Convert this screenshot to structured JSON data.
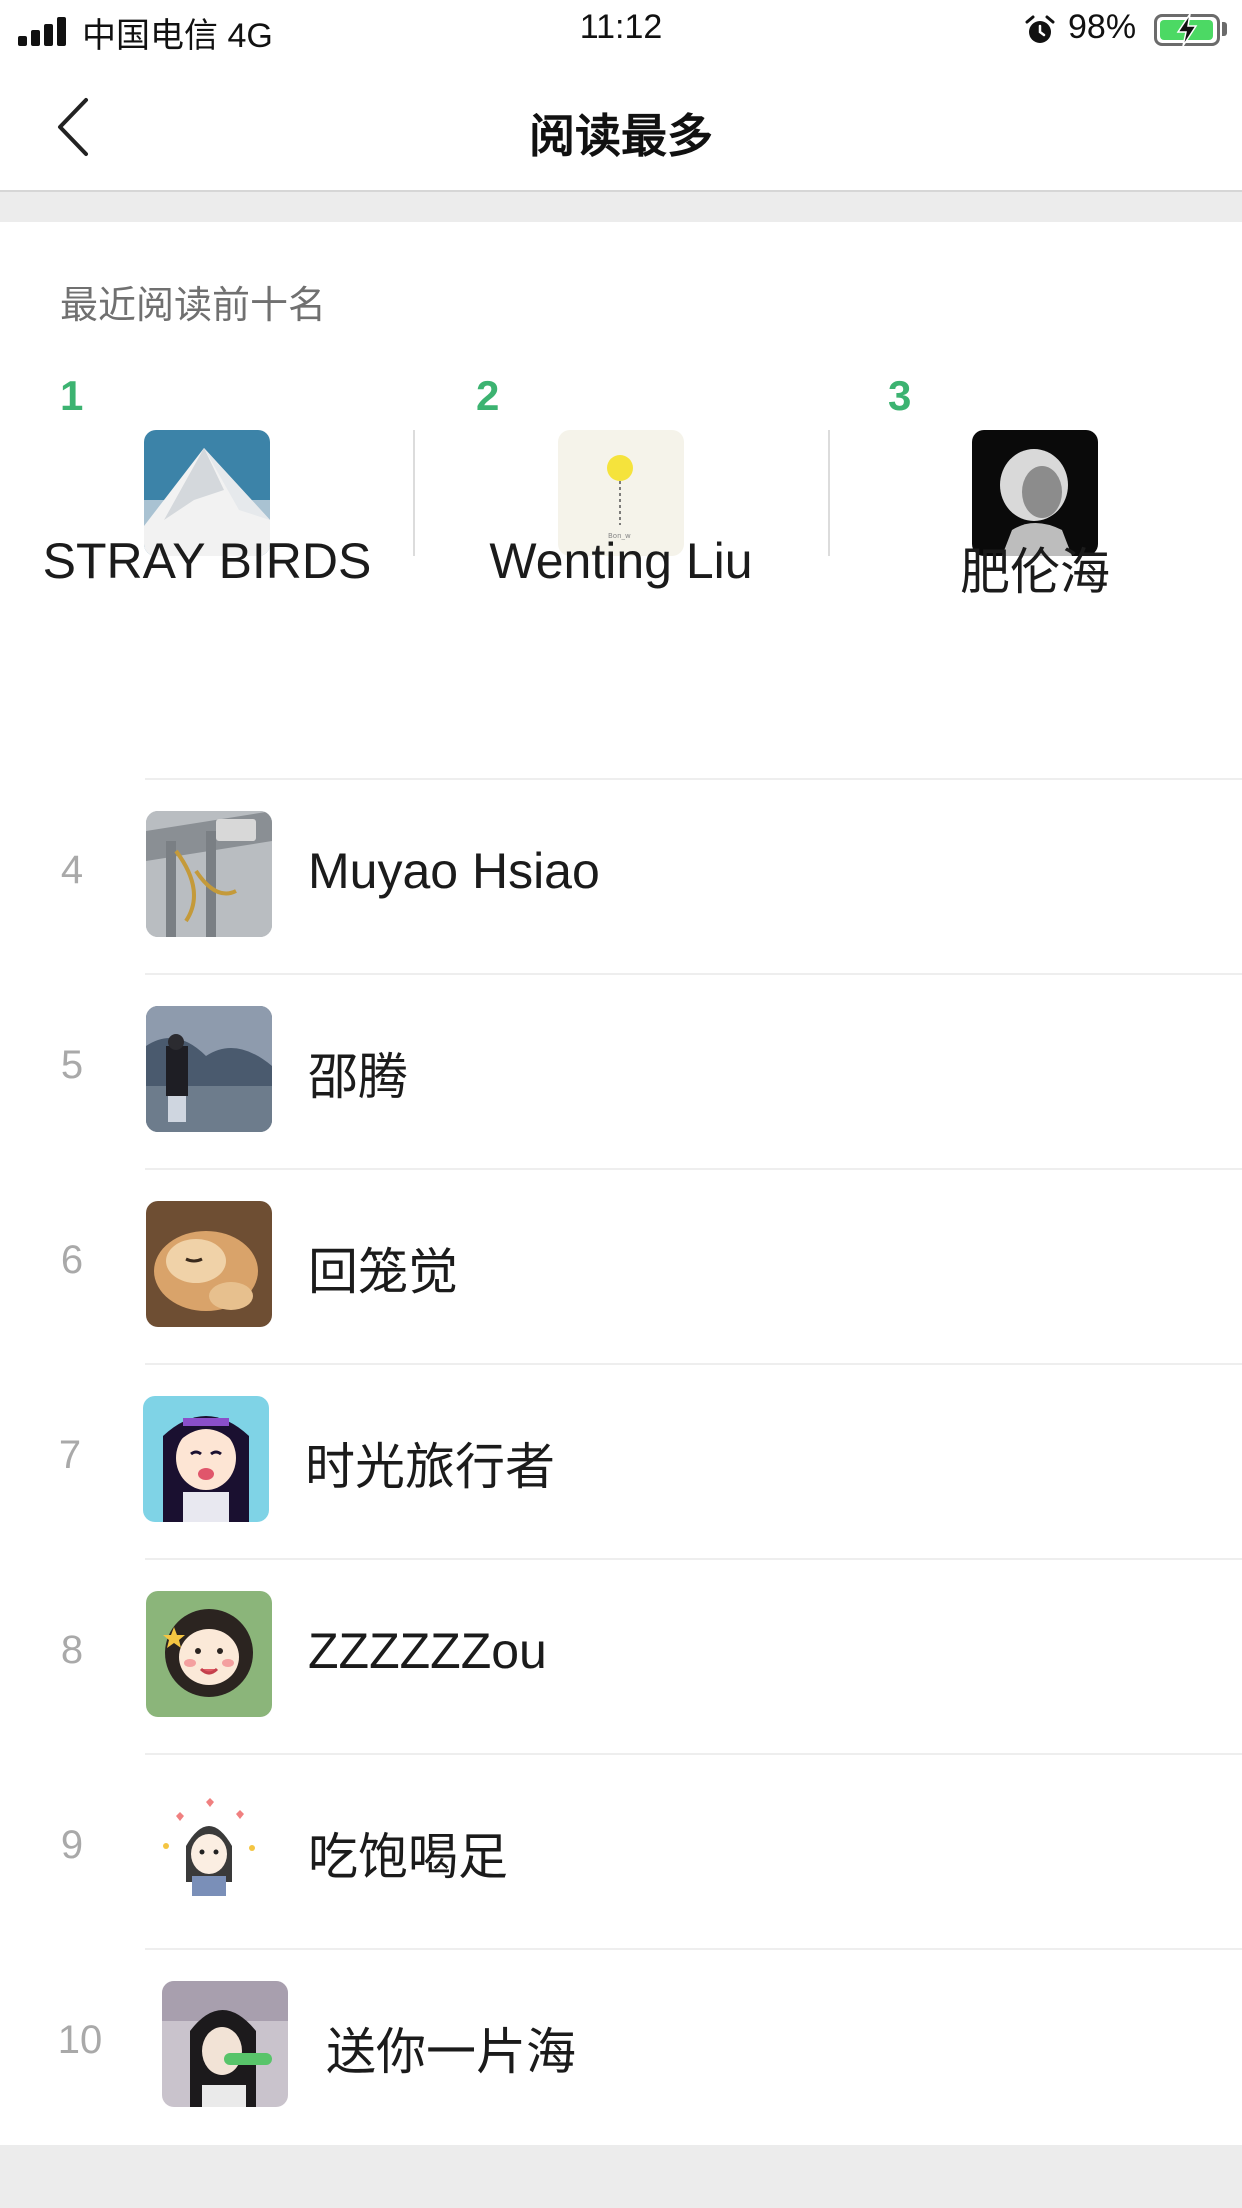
{
  "status_bar": {
    "carrier": "中国电信 4G",
    "time": "11:12",
    "battery_percent": "98%",
    "battery_level": 0.98
  },
  "nav": {
    "title": "阅读最多"
  },
  "section": {
    "label": "最近阅读前十名"
  },
  "top3": [
    {
      "rank": "1",
      "name": "STRAY BIRDS",
      "avatar": "snowy-mountain"
    },
    {
      "rank": "2",
      "name": "Wenting Liu",
      "avatar": "yellow-balloon"
    },
    {
      "rank": "3",
      "name": "肥伦海",
      "avatar": "black-white-portrait"
    }
  ],
  "list": [
    {
      "rank": "4",
      "name": "Muyao Hsiao",
      "avatar": "luggage-photo"
    },
    {
      "rank": "5",
      "name": "邵腾",
      "avatar": "rocky-beach-photo"
    },
    {
      "rank": "6",
      "name": "回笼觉",
      "avatar": "sleeping-dog-photo"
    },
    {
      "rank": "7",
      "name": "时光旅行者",
      "avatar": "anime-girl"
    },
    {
      "rank": "8",
      "name": "ZZZZZZou",
      "avatar": "curly-girl-cartoon"
    },
    {
      "rank": "9",
      "name": "吃饱喝足",
      "avatar": "girl-hearts-cartoon"
    },
    {
      "rank": "10",
      "name": "送你一片海",
      "avatar": "long-hair-girl-photo"
    }
  ],
  "colors": {
    "accent_green": "#3cb371",
    "rank_gray": "#a9a9a9",
    "background_gray": "#ececec"
  }
}
